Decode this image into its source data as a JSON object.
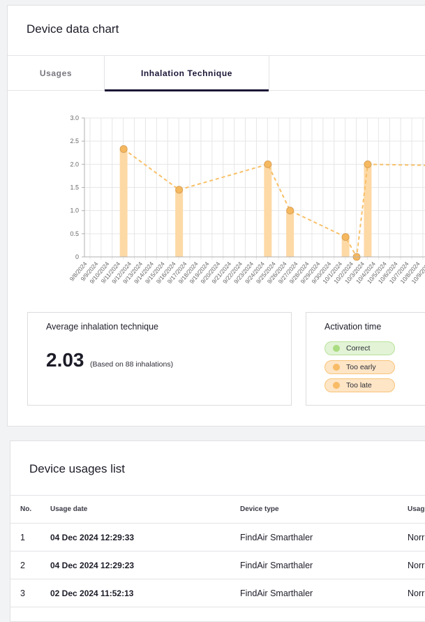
{
  "chart_card": {
    "title": "Device data chart",
    "tabs": [
      {
        "label": "Usages",
        "active": false
      },
      {
        "label": "Inhalation Technique",
        "active": true
      }
    ]
  },
  "chart_data": {
    "type": "bar",
    "overlay": "line",
    "title": "",
    "xlabel": "",
    "ylabel": "",
    "ylim": [
      0,
      3.0
    ],
    "yticks": [
      "0",
      "0.5",
      "1.0",
      "1.5",
      "2.0",
      "2.5",
      "3.0"
    ],
    "grid": true,
    "categories": [
      "9/8/2024",
      "9/9/2024",
      "9/10/2024",
      "9/11/2024",
      "9/12/2024",
      "9/13/2024",
      "9/14/2024",
      "9/15/2024",
      "9/16/2024",
      "9/17/2024",
      "9/18/2024",
      "9/19/2024",
      "9/20/2024",
      "9/21/2024",
      "9/22/2024",
      "9/23/2024",
      "9/24/2024",
      "9/25/2024",
      "9/26/2024",
      "9/27/2024",
      "9/28/2024",
      "9/29/2024",
      "9/30/2024",
      "10/1/2024",
      "10/2/2024",
      "10/3/2024",
      "10/4/2024",
      "10/5/2024",
      "10/6/2024",
      "10/7/2024",
      "10/8/2024",
      "10/9/2024"
    ],
    "series": [
      {
        "name": "Inhalation technique",
        "type": "bar+line",
        "points": [
          {
            "category": "9/11/2024",
            "value": 2.33
          },
          {
            "category": "9/16/2024",
            "value": 1.45
          },
          {
            "category": "9/24/2024",
            "value": 2.0
          },
          {
            "category": "9/26/2024",
            "value": 1.0
          },
          {
            "category": "10/1/2024",
            "value": 0.43
          },
          {
            "category": "10/2/2024",
            "value": 0
          },
          {
            "category": "10/3/2024",
            "value": 2.0
          }
        ],
        "continues_right_value": 1.97
      }
    ],
    "colors": {
      "bar": "#fdd9a6",
      "line": "#f8c068",
      "point": "#f6b85e",
      "point_stroke": "#d9a25a",
      "grid": "#e6e6e6",
      "axis": "#b0b0b0"
    }
  },
  "average": {
    "label": "Average inhalation technique",
    "value": "2.03",
    "note": "(Based on 88 inhalations)"
  },
  "activation": {
    "label": "Activation time",
    "items": [
      {
        "label": "Correct",
        "color": "#a9dc80"
      },
      {
        "label": "Too early",
        "color": "#f8bb66"
      },
      {
        "label": "Too late",
        "color": "#f8bb66"
      }
    ]
  },
  "usages_list": {
    "title": "Device usages list",
    "columns": [
      "No.",
      "Usage date",
      "Device type",
      "Usag"
    ],
    "rows": [
      {
        "no": "1",
        "date": "04 Dec 2024 12:29:33",
        "device": "FindAir Smarthaler",
        "usage": "Norr"
      },
      {
        "no": "2",
        "date": "04 Dec 2024 12:29:23",
        "device": "FindAir Smarthaler",
        "usage": "Norr"
      },
      {
        "no": "3",
        "date": "02 Dec 2024 11:52:13",
        "device": "FindAir Smarthaler",
        "usage": "Norr"
      }
    ]
  }
}
